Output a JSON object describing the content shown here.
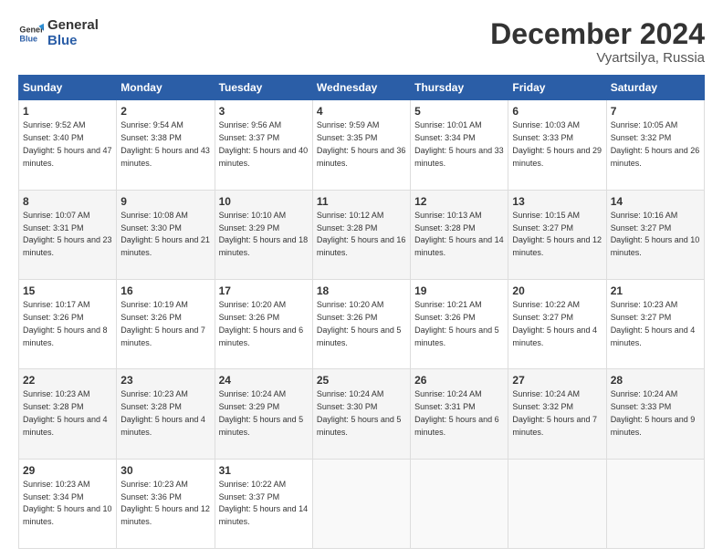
{
  "logo": {
    "line1": "General",
    "line2": "Blue"
  },
  "title": "December 2024",
  "subtitle": "Vyartsilya, Russia",
  "headers": [
    "Sunday",
    "Monday",
    "Tuesday",
    "Wednesday",
    "Thursday",
    "Friday",
    "Saturday"
  ],
  "weeks": [
    [
      {
        "day": "1",
        "sunrise": "9:52 AM",
        "sunset": "3:40 PM",
        "daylight": "5 hours and 47 minutes."
      },
      {
        "day": "2",
        "sunrise": "9:54 AM",
        "sunset": "3:38 PM",
        "daylight": "5 hours and 43 minutes."
      },
      {
        "day": "3",
        "sunrise": "9:56 AM",
        "sunset": "3:37 PM",
        "daylight": "5 hours and 40 minutes."
      },
      {
        "day": "4",
        "sunrise": "9:59 AM",
        "sunset": "3:35 PM",
        "daylight": "5 hours and 36 minutes."
      },
      {
        "day": "5",
        "sunrise": "10:01 AM",
        "sunset": "3:34 PM",
        "daylight": "5 hours and 33 minutes."
      },
      {
        "day": "6",
        "sunrise": "10:03 AM",
        "sunset": "3:33 PM",
        "daylight": "5 hours and 29 minutes."
      },
      {
        "day": "7",
        "sunrise": "10:05 AM",
        "sunset": "3:32 PM",
        "daylight": "5 hours and 26 minutes."
      }
    ],
    [
      {
        "day": "8",
        "sunrise": "10:07 AM",
        "sunset": "3:31 PM",
        "daylight": "5 hours and 23 minutes."
      },
      {
        "day": "9",
        "sunrise": "10:08 AM",
        "sunset": "3:30 PM",
        "daylight": "5 hours and 21 minutes."
      },
      {
        "day": "10",
        "sunrise": "10:10 AM",
        "sunset": "3:29 PM",
        "daylight": "5 hours and 18 minutes."
      },
      {
        "day": "11",
        "sunrise": "10:12 AM",
        "sunset": "3:28 PM",
        "daylight": "5 hours and 16 minutes."
      },
      {
        "day": "12",
        "sunrise": "10:13 AM",
        "sunset": "3:28 PM",
        "daylight": "5 hours and 14 minutes."
      },
      {
        "day": "13",
        "sunrise": "10:15 AM",
        "sunset": "3:27 PM",
        "daylight": "5 hours and 12 minutes."
      },
      {
        "day": "14",
        "sunrise": "10:16 AM",
        "sunset": "3:27 PM",
        "daylight": "5 hours and 10 minutes."
      }
    ],
    [
      {
        "day": "15",
        "sunrise": "10:17 AM",
        "sunset": "3:26 PM",
        "daylight": "5 hours and 8 minutes."
      },
      {
        "day": "16",
        "sunrise": "10:19 AM",
        "sunset": "3:26 PM",
        "daylight": "5 hours and 7 minutes."
      },
      {
        "day": "17",
        "sunrise": "10:20 AM",
        "sunset": "3:26 PM",
        "daylight": "5 hours and 6 minutes."
      },
      {
        "day": "18",
        "sunrise": "10:20 AM",
        "sunset": "3:26 PM",
        "daylight": "5 hours and 5 minutes."
      },
      {
        "day": "19",
        "sunrise": "10:21 AM",
        "sunset": "3:26 PM",
        "daylight": "5 hours and 5 minutes."
      },
      {
        "day": "20",
        "sunrise": "10:22 AM",
        "sunset": "3:27 PM",
        "daylight": "5 hours and 4 minutes."
      },
      {
        "day": "21",
        "sunrise": "10:23 AM",
        "sunset": "3:27 PM",
        "daylight": "5 hours and 4 minutes."
      }
    ],
    [
      {
        "day": "22",
        "sunrise": "10:23 AM",
        "sunset": "3:28 PM",
        "daylight": "5 hours and 4 minutes."
      },
      {
        "day": "23",
        "sunrise": "10:23 AM",
        "sunset": "3:28 PM",
        "daylight": "5 hours and 4 minutes."
      },
      {
        "day": "24",
        "sunrise": "10:24 AM",
        "sunset": "3:29 PM",
        "daylight": "5 hours and 5 minutes."
      },
      {
        "day": "25",
        "sunrise": "10:24 AM",
        "sunset": "3:30 PM",
        "daylight": "5 hours and 5 minutes."
      },
      {
        "day": "26",
        "sunrise": "10:24 AM",
        "sunset": "3:31 PM",
        "daylight": "5 hours and 6 minutes."
      },
      {
        "day": "27",
        "sunrise": "10:24 AM",
        "sunset": "3:32 PM",
        "daylight": "5 hours and 7 minutes."
      },
      {
        "day": "28",
        "sunrise": "10:24 AM",
        "sunset": "3:33 PM",
        "daylight": "5 hours and 9 minutes."
      }
    ],
    [
      {
        "day": "29",
        "sunrise": "10:23 AM",
        "sunset": "3:34 PM",
        "daylight": "5 hours and 10 minutes."
      },
      {
        "day": "30",
        "sunrise": "10:23 AM",
        "sunset": "3:36 PM",
        "daylight": "5 hours and 12 minutes."
      },
      {
        "day": "31",
        "sunrise": "10:22 AM",
        "sunset": "3:37 PM",
        "daylight": "5 hours and 14 minutes."
      },
      null,
      null,
      null,
      null
    ]
  ]
}
